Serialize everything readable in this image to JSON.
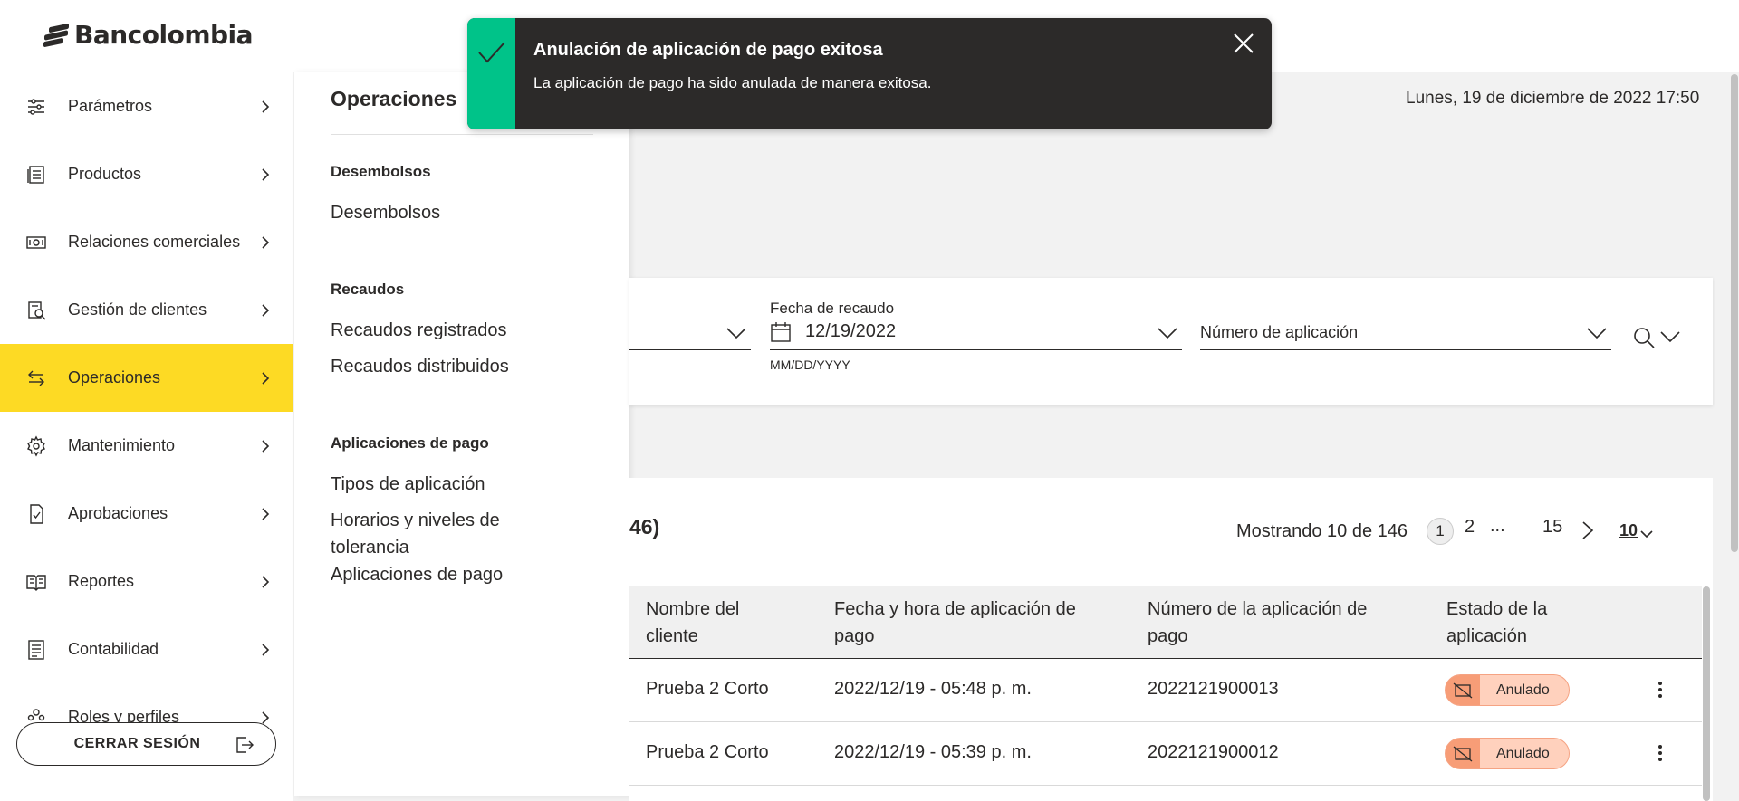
{
  "brand": {
    "name": "Bancolombia"
  },
  "sidebar": {
    "items": [
      {
        "label": "Parámetros",
        "icon": "sliders-icon"
      },
      {
        "label": "Productos",
        "icon": "document-list-icon"
      },
      {
        "label": "Relaciones comerciales",
        "icon": "money-bill-icon"
      },
      {
        "label": "Gestión de clientes",
        "icon": "client-search-icon"
      },
      {
        "label": "Operaciones",
        "icon": "arrows-exchange-icon",
        "active": true
      },
      {
        "label": "Mantenimiento",
        "icon": "gear-icon"
      },
      {
        "label": "Aprobaciones",
        "icon": "document-check-icon"
      },
      {
        "label": "Reportes",
        "icon": "book-open-icon"
      },
      {
        "label": "Contabilidad",
        "icon": "ledger-icon"
      },
      {
        "label": "Roles y perfiles",
        "icon": "users-icon"
      }
    ],
    "logout_label": "CERRAR SESIÓN"
  },
  "submenu": {
    "title": "Operaciones",
    "groups": [
      {
        "title": "Desembolsos",
        "links": [
          "Desembolsos"
        ]
      },
      {
        "title": "Recaudos",
        "links": [
          "Recaudos registrados",
          "Recaudos distribuidos"
        ]
      },
      {
        "title": "Aplicaciones de pago",
        "links": [
          "Tipos de aplicación",
          "Horarios y niveles de tolerancia",
          "Aplicaciones de pago"
        ]
      }
    ]
  },
  "header": {
    "date": "Lunes, 19 de diciembre de 2022 17:50"
  },
  "filters": {
    "fecha_label": "Fecha de recaudo",
    "fecha_value": "12/19/2022",
    "fecha_help": "MM/DD/YYYY",
    "numero_placeholder": "Número de aplicación"
  },
  "results": {
    "title_fragment": "46)",
    "showing": "Mostrando 10 de 146",
    "pages": [
      "1",
      "2",
      "...",
      "15"
    ],
    "current_page": "1",
    "page_size": "10",
    "columns": [
      "Nombre del cliente",
      "Fecha y hora de aplicación de pago",
      "Número de la aplicación de pago",
      "Estado de la aplicación"
    ],
    "rows": [
      {
        "cliente": "Prueba 2 Corto",
        "fecha": "2022/12/19 - 05:48 p. m.",
        "numero": "2022121900013",
        "estado": "Anulado"
      },
      {
        "cliente": "Prueba 2 Corto",
        "fecha": "2022/12/19 - 05:39 p. m.",
        "numero": "2022121900012",
        "estado": "Anulado"
      }
    ]
  },
  "toast": {
    "title": "Anulación de aplicación de pago exitosa",
    "message": "La aplicación de pago ha sido anulada de manera exitosa.",
    "accent": "#00c389"
  },
  "colors": {
    "primary_yellow": "#fdda24",
    "dark": "#2c2a29",
    "badge_bg": "#ffd1bd"
  }
}
